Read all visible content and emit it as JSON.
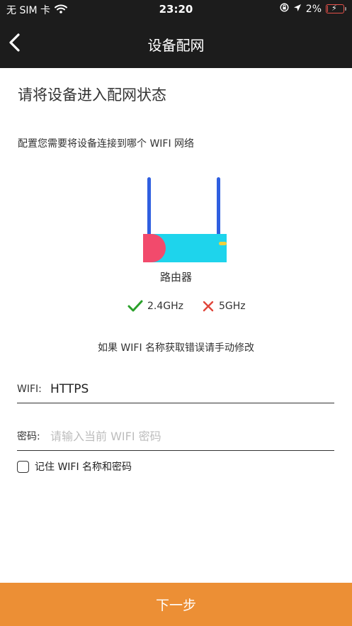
{
  "status_bar": {
    "carrier": "无 SIM 卡",
    "time": "23:20",
    "battery_percent": "2%",
    "battery_level": 0.02,
    "icons": [
      "wifi-icon",
      "orientation-lock-icon",
      "location-icon",
      "battery-charging-icon"
    ]
  },
  "nav": {
    "title": "设备配网",
    "back_icon": "chevron-left-icon"
  },
  "content": {
    "title": "请将设备进入配网状态",
    "description": "配置您需要将设备连接到哪个 WIFI 网络",
    "router_label": "路由器",
    "frequencies": [
      {
        "label": "2.4GHz",
        "supported": true,
        "icon": "check-icon",
        "color": "#2aa02a"
      },
      {
        "label": "5GHz",
        "supported": false,
        "icon": "cross-icon",
        "color": "#e0453a"
      }
    ],
    "hint": "如果 WIFI 名称获取错误请手动修改"
  },
  "form": {
    "wifi_label": "WIFI:",
    "wifi_value": "HTTPS",
    "password_label": "密码:",
    "password_placeholder": "请输入当前 WIFI 密码",
    "password_value": "",
    "remember_label": "记住 WIFI 名称和密码",
    "remember_checked": false
  },
  "footer": {
    "next_label": "下一步"
  },
  "colors": {
    "header_bg": "#1c1c1c",
    "accent": "#ec8f35",
    "router_body": "#1ed4ec",
    "router_antenna": "#2f5fe0",
    "router_accent": "#f24a6c",
    "router_led": "#f2d03c"
  }
}
